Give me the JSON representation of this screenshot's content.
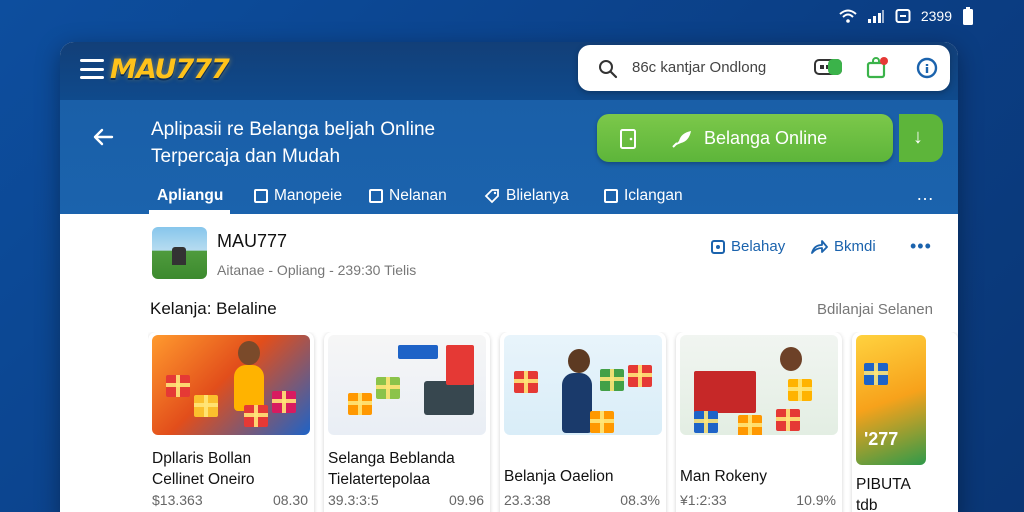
{
  "status_bar": {
    "time": "2399"
  },
  "topbar": {
    "logo_text": "MAU777",
    "search_text": "86c kantjar Ondlong"
  },
  "header": {
    "title_line1": "Aplipasii re Belanga beljah Online",
    "title_line2": "Terpercaja dan Mudah",
    "cta_label": "Belanga Online",
    "tabs": [
      {
        "label": "Apliangu",
        "active": true
      },
      {
        "label": "Manopeie"
      },
      {
        "label": "Nelanan"
      },
      {
        "label": "Blielanya"
      },
      {
        "label": "Iclangan"
      }
    ],
    "more_symbol": "…"
  },
  "profile": {
    "name": "MAU777",
    "subtitle": "Aitanae - Opliang - 239:30 Tielis",
    "actions": [
      {
        "label": "Belahay"
      },
      {
        "label": "Bkmdi"
      }
    ],
    "more_symbol": "•••"
  },
  "section": {
    "title": "Kelanja: Belaline",
    "link": "Bdilanjai Selanen"
  },
  "cards": [
    {
      "title_line1": "Dpllaris Bollan",
      "title_line2": "Cellinet Oneiro",
      "price": "$13.363",
      "rating": "08.30"
    },
    {
      "title_line1": "Selanga Beblanda",
      "title_line2": "Tielatertepolaa",
      "price": "39.3:3:5",
      "rating": "09.96"
    },
    {
      "title_line1": "Belanja Oaelion",
      "title_line2": "",
      "price": "23.3:38",
      "rating": "08.3%"
    },
    {
      "title_line1": "Man Rokeny",
      "title_line2": "",
      "price": "¥1:2:33",
      "rating": "10.9%"
    },
    {
      "title_line1": "PIBUTA",
      "title_line2": "tdb",
      "price": "",
      "rating": "",
      "badge": "'277"
    }
  ],
  "colors": {
    "brand_blue": "#1b63ad",
    "topbar_blue": "#123f78",
    "cta_green": "#6cbf44",
    "logo_gold": "#ffc21a"
  }
}
